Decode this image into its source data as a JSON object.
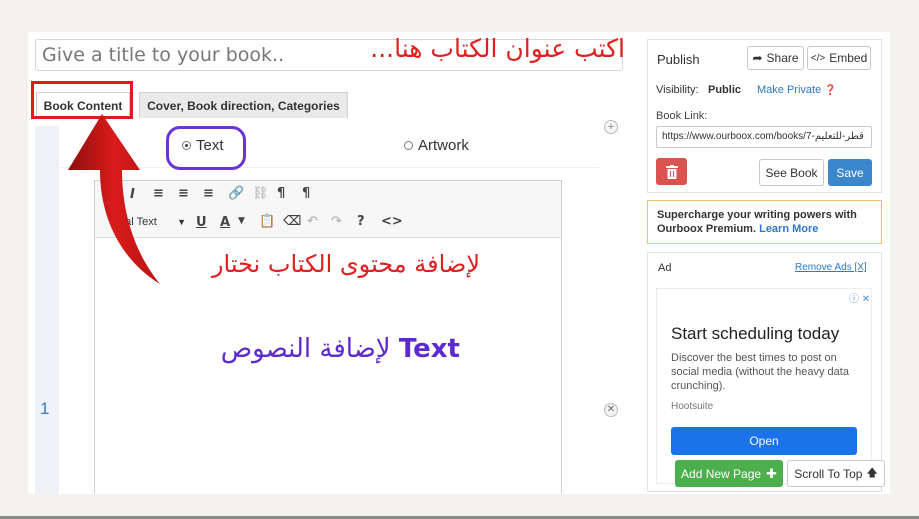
{
  "title_field": {
    "placeholder": "Give a title to your book..",
    "annotation": "اكتب عنوان الكتاب هنا..."
  },
  "tabs": [
    {
      "label": "Book Content"
    },
    {
      "label": "Cover, Book direction, Categories"
    }
  ],
  "editor": {
    "type_options": {
      "text": "Text",
      "artwork": "Artwork",
      "selected": "Text"
    },
    "format_select": "mal Text",
    "line_number": "1",
    "annotation_choose": "لإضافة محتوى الكتاب نختار",
    "annotation_text_bold": "Text",
    "annotation_text_rest": "لإضافة النصوص"
  },
  "publish": {
    "title": "Publish",
    "share_label": "Share",
    "embed_label": "Embed",
    "visibility_label": "Visibility:",
    "visibility_value": "Public",
    "make_private": "Make Private",
    "book_link_label": "Book Link:",
    "book_link_value": "https://www.ourboox.com/books/7-قطر-للتعليم",
    "see_book": "See Book",
    "save": "Save"
  },
  "premium": {
    "text": "Supercharge your writing powers with Ourboox Premium.",
    "learn_more": "Learn More"
  },
  "ad": {
    "label": "Ad",
    "remove_ads": "Remove Ads [X]",
    "headline": "Start scheduling today",
    "description": "Discover the best times to post on social media (without the heavy data crunching).",
    "source": "Hootsuite",
    "cta": "Open"
  },
  "footer_buttons": {
    "add_new_page": "Add New Page",
    "scroll_to_top": "Scroll To Top"
  },
  "colors": {
    "annotation_red": "#e02020",
    "annotation_purple": "#5b2bd1",
    "save_blue": "#3c87cc",
    "add_green": "#4cae4c",
    "delete_red": "#d9534f"
  }
}
